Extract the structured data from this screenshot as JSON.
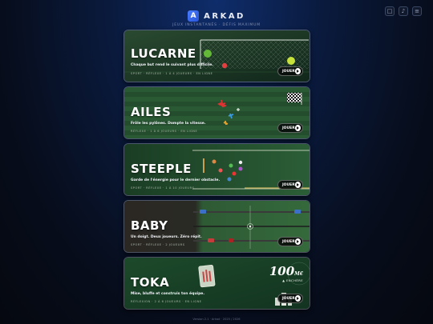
{
  "header": {
    "logo_letter": "A",
    "brand": "ARKAD",
    "tagline": "JEUX INSTANTANÉS · DÉFIS MAXIMUM"
  },
  "top_icons": [
    "□",
    "♪",
    "≡"
  ],
  "cards": [
    {
      "title": "LUCARNE",
      "subtitle": "Chaque but rend le suivant plus difficile.",
      "meta": "SPORT · RÉFLEXE · 1 À 4 JOUEURS · EN LIGNE",
      "button": "JOUER"
    },
    {
      "title": "AILES",
      "subtitle": "Frôle les pylônes. Dompte la vitesse.",
      "meta": "RÉFLEXE · 1 À 6 JOUEURS · EN LIGNE",
      "button": "JOUER"
    },
    {
      "title": "STEEPLE",
      "subtitle": "Garde de l'énergie pour le dernier obstacle.",
      "meta": "SPORT · RÉFLEXE · 1 À 10 JOUEURS",
      "button": "JOUER"
    },
    {
      "title": "BABY",
      "subtitle": "Un doigt. Deux joueurs. Zéro répit.",
      "meta": "SPORT · RÉFLEXE · 2 JOUEURS",
      "button": "JOUER"
    },
    {
      "title": "TOKA",
      "subtitle": "Mise, bluffe et construis ton équipe.",
      "meta": "RÉFLEXION · 2 À 6 JOUEURS · EN LIGNE",
      "button": "JOUER",
      "prize_amount": "100",
      "prize_currency": "M€",
      "prize_label": "▲ ENCHÈRE"
    }
  ],
  "footer": "Version 2.1 · Arkad · 2025 / 2026",
  "colors": {
    "accent": "#3b6cf5",
    "lucarne_bg": "#1a3a22",
    "ailes_bg": "#214a2b",
    "steeple_bg": "#1f4e2e",
    "baby_bg": "#2a2622",
    "toka_bg": "#1d4426"
  }
}
